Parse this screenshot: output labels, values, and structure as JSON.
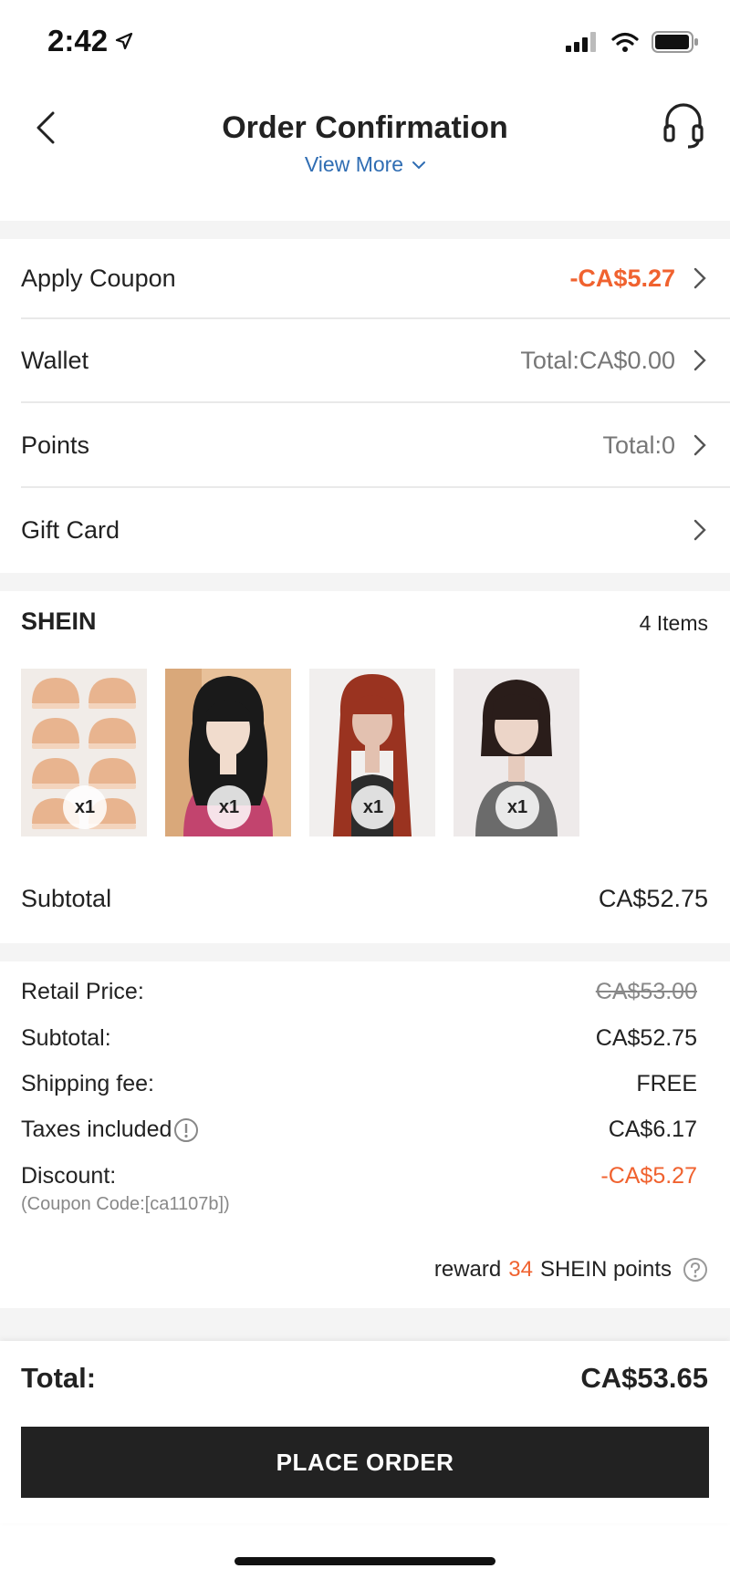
{
  "status_bar": {
    "time": "2:42"
  },
  "header": {
    "title": "Order Confirmation",
    "view_more": "View More"
  },
  "rows": {
    "coupon": {
      "label": "Apply Coupon",
      "value": "-CA$5.27"
    },
    "wallet": {
      "label": "Wallet",
      "value": "Total:CA$0.00"
    },
    "points": {
      "label": "Points",
      "value": "Total:0"
    },
    "gift_card": {
      "label": "Gift Card"
    }
  },
  "store": {
    "name": "SHEIN",
    "item_count": "4 Items",
    "items": [
      {
        "qty": "x1",
        "icon": "wig-caps-image"
      },
      {
        "qty": "x1",
        "icon": "black-wavy-wig-image"
      },
      {
        "qty": "x1",
        "icon": "red-long-wig-image"
      },
      {
        "qty": "x1",
        "icon": "black-bob-wig-image"
      }
    ],
    "subtotal_label": "Subtotal",
    "subtotal_value": "CA$52.75"
  },
  "breakdown": {
    "retail_label": "Retail Price:",
    "retail_value": "CA$53.00",
    "subtotal_label": "Subtotal:",
    "subtotal_value": "CA$52.75",
    "shipping_label": "Shipping fee:",
    "shipping_value": "FREE",
    "taxes_label": "Taxes included",
    "taxes_value": "CA$6.17",
    "discount_label": "Discount:",
    "discount_value": "-CA$5.27",
    "coupon_code": "(Coupon Code:[ca1107b])",
    "reward_prefix": "reward",
    "reward_points": "34",
    "reward_suffix": "SHEIN points"
  },
  "footer": {
    "total_label": "Total:",
    "total_value": "CA$53.65",
    "place_order": "PLACE ORDER"
  },
  "colors": {
    "accent": "#f0622f",
    "link": "#2f6db3",
    "button": "#222222"
  }
}
